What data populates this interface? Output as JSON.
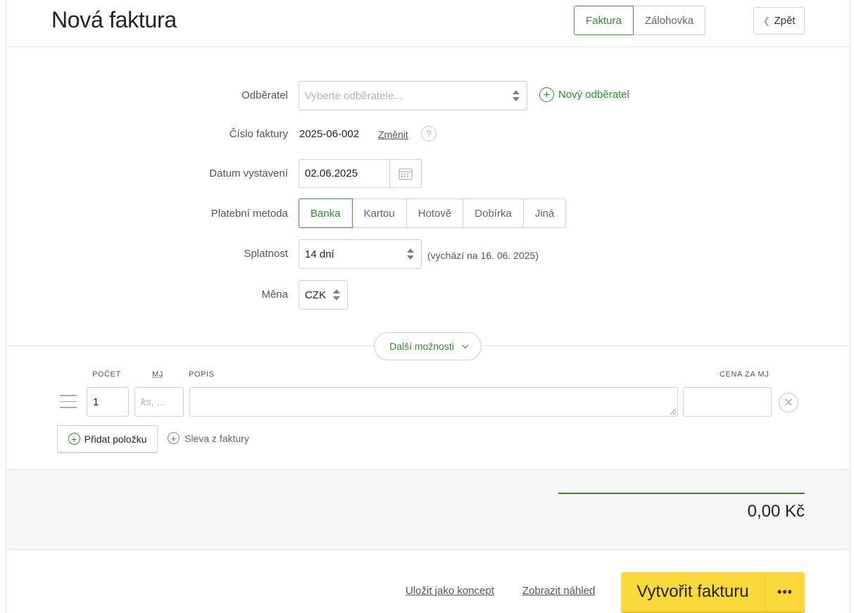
{
  "header": {
    "title": "Nová faktura",
    "type_tabs": [
      {
        "label": "Faktura",
        "active": true
      },
      {
        "label": "Zálohovka",
        "active": false
      }
    ],
    "back_label": "Zpět"
  },
  "form": {
    "customer": {
      "label": "Odběratel",
      "placeholder": "Vyberte odběratele...",
      "new_label": "Nový odběratel"
    },
    "invoice_number": {
      "label": "Číslo faktury",
      "value": "2025-06-002",
      "change_label": "Změnit",
      "help_glyph": "?"
    },
    "issue_date": {
      "label": "Datum vystavení",
      "value": "02.06.2025"
    },
    "payment_method": {
      "label": "Platební metoda",
      "options": [
        "Banka",
        "Kartou",
        "Hotově",
        "Dobírka",
        "Jiná"
      ],
      "selected": "Banka"
    },
    "due": {
      "label": "Splatnost",
      "value": "14 dní",
      "note": "(vychází na 16. 06. 2025)"
    },
    "currency": {
      "label": "Měna",
      "value": "CZK"
    },
    "more_options_label": "Další možnosti"
  },
  "items": {
    "headers": {
      "count": "Počet",
      "unit": "MJ",
      "description": "Popis",
      "price": "Cena za MJ"
    },
    "rows": [
      {
        "count": "1",
        "unit_placeholder": "ks, ...",
        "description": "",
        "price": ""
      }
    ],
    "add_item_label": "Přidat položku",
    "discount_label": "Sleva z faktury"
  },
  "totals": {
    "total": "0,00 Kč"
  },
  "footer": {
    "save_draft_label": "Uložit jako koncept",
    "preview_label": "Zobrazit náhled",
    "create_label": "Vytvořit fakturu",
    "more_label": "•••"
  },
  "colors": {
    "accent": "#2e8b2e",
    "primary_button": "#fcd93b",
    "totals_bg": "#f7f7f7"
  }
}
